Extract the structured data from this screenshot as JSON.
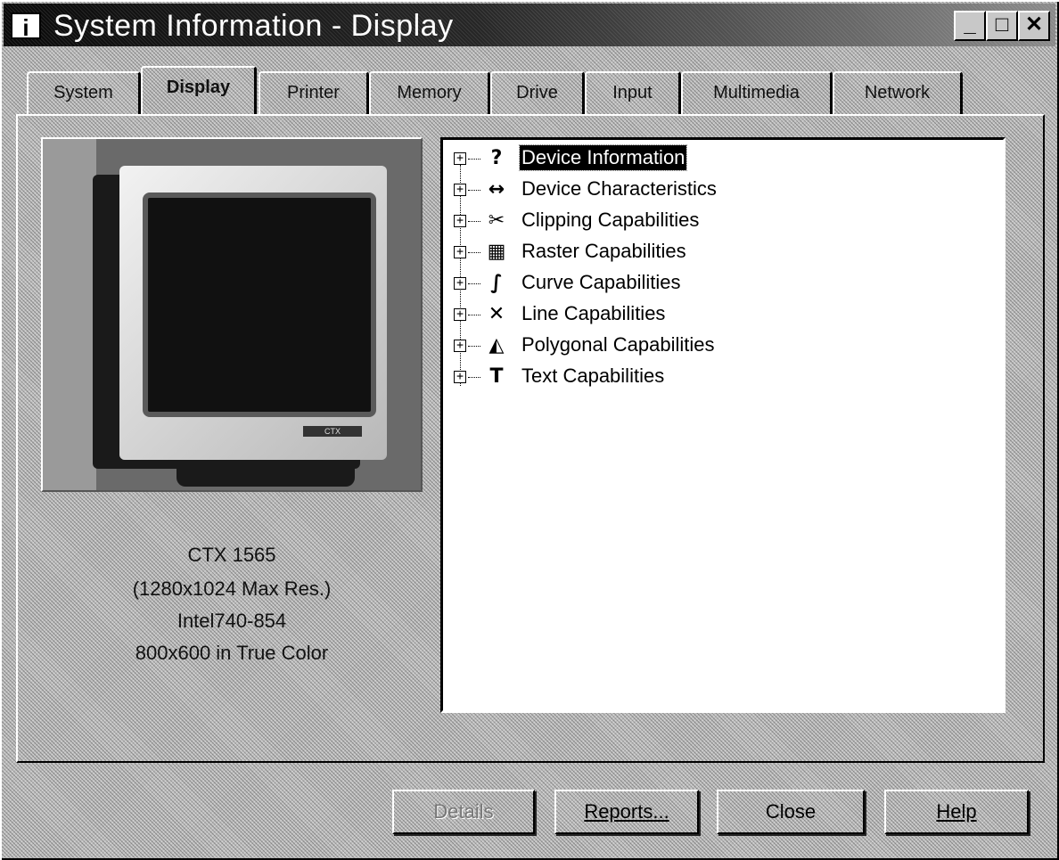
{
  "window": {
    "title": "System Information - Display",
    "app_icon": "i",
    "icon_names": [
      "app-info-icon",
      "minimize-icon",
      "maximize-icon",
      "close-icon"
    ]
  },
  "titlebar_buttons": {
    "minimize": "_",
    "maximize": "□",
    "close": "✕"
  },
  "tabs": [
    {
      "label": "System"
    },
    {
      "label": "Display",
      "active": true
    },
    {
      "label": "Printer"
    },
    {
      "label": "Memory"
    },
    {
      "label": "Drive"
    },
    {
      "label": "Input"
    },
    {
      "label": "Multimedia"
    },
    {
      "label": "Network"
    }
  ],
  "monitor": {
    "badge": "CTX",
    "info_lines": [
      "CTX 1565",
      "(1280x1024 Max Res.)",
      "Intel740-854",
      "800x600 in True Color"
    ]
  },
  "tree": {
    "items": [
      {
        "label": "Device Information",
        "icon": "?",
        "icon_name": "question-icon",
        "expander": "+",
        "selected": true
      },
      {
        "label": "Device Characteristics",
        "icon": "↔",
        "icon_name": "device-characteristics-icon",
        "expander": "+"
      },
      {
        "label": "Clipping Capabilities",
        "icon": "✂",
        "icon_name": "clipping-icon",
        "expander": "+"
      },
      {
        "label": "Raster Capabilities",
        "icon": "▦",
        "icon_name": "raster-icon",
        "expander": "+"
      },
      {
        "label": "Curve Capabilities",
        "icon": "∫",
        "icon_name": "curve-icon",
        "expander": "+"
      },
      {
        "label": "Line Capabilities",
        "icon": "✕",
        "icon_name": "line-icon",
        "expander": "+"
      },
      {
        "label": "Polygonal Capabilities",
        "icon": "◭",
        "icon_name": "polygon-icon",
        "expander": "+"
      },
      {
        "label": "Text Capabilities",
        "icon": "T",
        "icon_name": "text-icon",
        "expander": "+"
      }
    ]
  },
  "buttons": {
    "details": "Details",
    "reports": "Reports...",
    "close": "Close",
    "help": "Help"
  }
}
